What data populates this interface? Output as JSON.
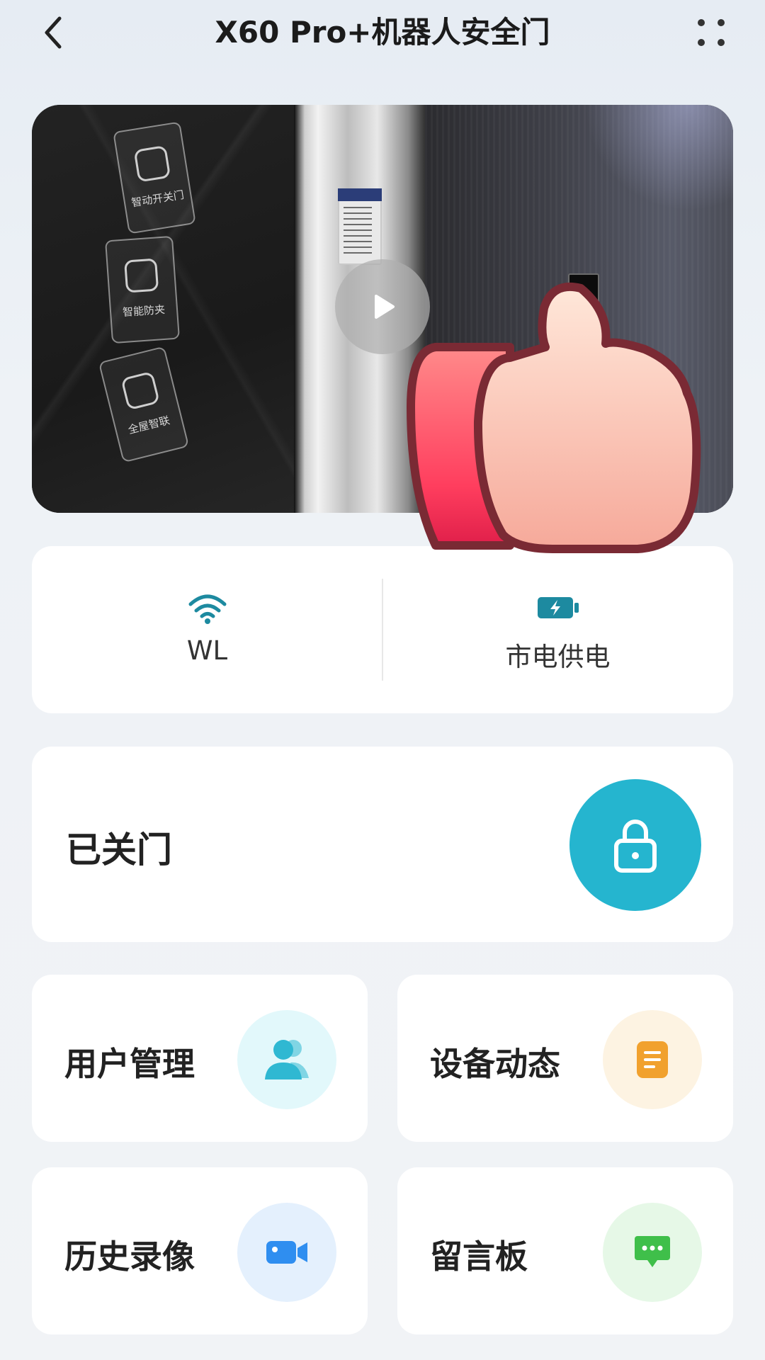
{
  "header": {
    "title": "X60 Pro+机器人安全门"
  },
  "video": {
    "wall_panels": [
      {
        "label": "智动开关门"
      },
      {
        "label": "智能防夹"
      },
      {
        "label": "全屋智联"
      }
    ]
  },
  "status": {
    "network_label": "WL",
    "power_label": "市电供电"
  },
  "lock": {
    "state_label": "已关门"
  },
  "tiles": [
    {
      "label": "用户管理",
      "icon": "users-icon",
      "color": "#2fb8d2",
      "bg": "#e2f8fb"
    },
    {
      "label": "设备动态",
      "icon": "document-icon",
      "color": "#f1a12e",
      "bg": "#fdf3e2"
    },
    {
      "label": "历史录像",
      "icon": "video-camera-icon",
      "color": "#2f8ef0",
      "bg": "#e4f0fd"
    },
    {
      "label": "留言板",
      "icon": "message-icon",
      "color": "#3fbf4a",
      "bg": "#e6f8e7"
    }
  ],
  "colors": {
    "accent": "#25b5cf",
    "status_icon": "#1d8aa0"
  }
}
